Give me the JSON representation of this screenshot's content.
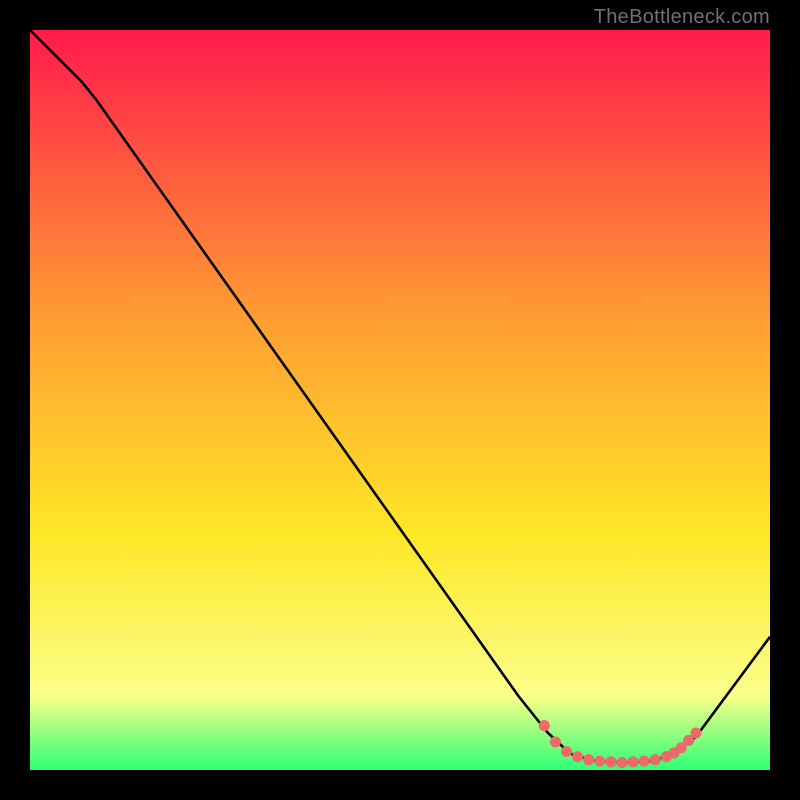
{
  "credit": "TheBottleneck.com",
  "colors": {
    "top": "#ff1a4c",
    "mid1": "#ff9a33",
    "mid2": "#ffe727",
    "mid3": "#fbff8a",
    "bottom": "#2dff76",
    "curve": "#000000",
    "dot": "#ee6a6a"
  },
  "chart_data": {
    "type": "line",
    "title": "",
    "xlabel": "",
    "ylabel": "",
    "xlim": [
      0,
      100
    ],
    "ylim": [
      0,
      100
    ],
    "curve": [
      {
        "x": 0,
        "y": 100
      },
      {
        "x": 7,
        "y": 93
      },
      {
        "x": 9,
        "y": 90.5
      },
      {
        "x": 66,
        "y": 10
      },
      {
        "x": 70,
        "y": 5
      },
      {
        "x": 73,
        "y": 2.2
      },
      {
        "x": 76,
        "y": 1.3
      },
      {
        "x": 80,
        "y": 1.0
      },
      {
        "x": 84,
        "y": 1.2
      },
      {
        "x": 87,
        "y": 2.2
      },
      {
        "x": 90,
        "y": 4.5
      },
      {
        "x": 100,
        "y": 18
      }
    ],
    "dots": [
      {
        "x": 69.5,
        "y": 6.0
      },
      {
        "x": 71.0,
        "y": 3.8
      },
      {
        "x": 72.5,
        "y": 2.5
      },
      {
        "x": 74.0,
        "y": 1.8
      },
      {
        "x": 75.5,
        "y": 1.4
      },
      {
        "x": 77.0,
        "y": 1.2
      },
      {
        "x": 78.5,
        "y": 1.1
      },
      {
        "x": 80.0,
        "y": 1.0
      },
      {
        "x": 81.5,
        "y": 1.1
      },
      {
        "x": 83.0,
        "y": 1.2
      },
      {
        "x": 84.5,
        "y": 1.4
      },
      {
        "x": 86.0,
        "y": 1.8
      },
      {
        "x": 87.0,
        "y": 2.3
      },
      {
        "x": 88.0,
        "y": 3.0
      },
      {
        "x": 89.0,
        "y": 4.0
      },
      {
        "x": 90.0,
        "y": 5.0
      }
    ]
  }
}
